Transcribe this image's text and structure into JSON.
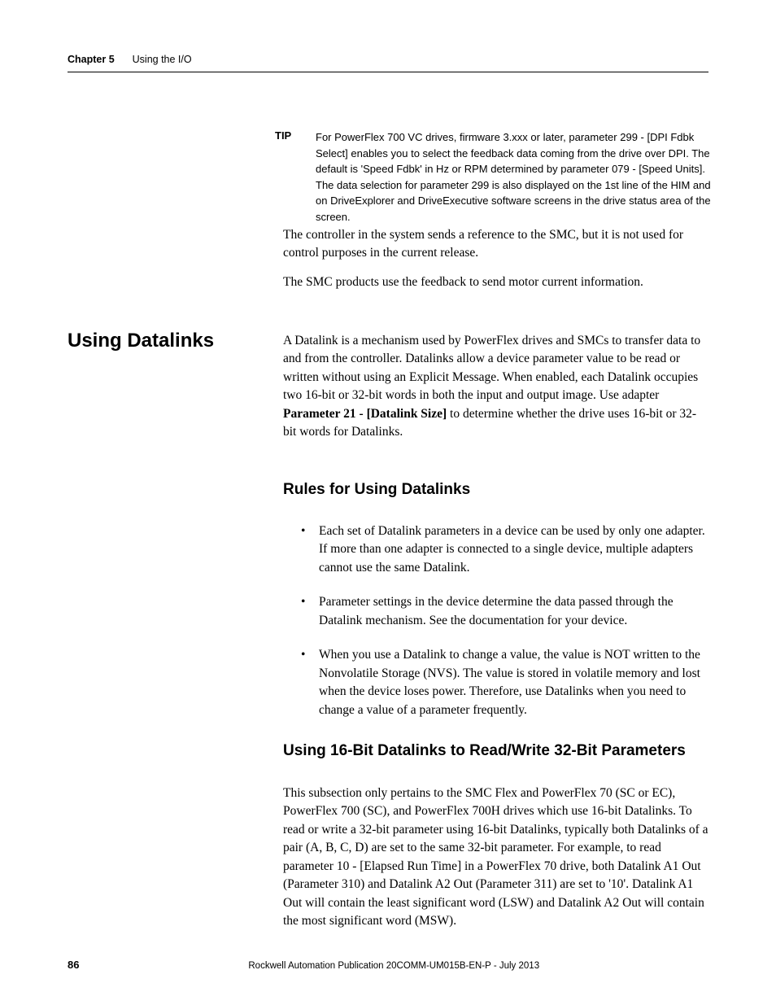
{
  "header": {
    "chapter": "Chapter 5",
    "title": "Using the I/O"
  },
  "tip": {
    "label": "TIP",
    "text": "For PowerFlex 700 VC drives, firmware 3.xxx or later, parameter 299 - [DPI Fdbk Select] enables you to select the feedback data coming from the drive over DPI. The default is 'Speed Fdbk' in Hz or RPM determined by parameter 079 - [Speed Units]. The data selection for parameter 299 is also displayed on the 1st line of the HIM and on DriveExplorer and DriveExecutive software screens in the drive status area of the screen."
  },
  "body_paras": [
    "The controller in the system sends a reference to the SMC, but it is not used for control purposes in the current release.",
    "The SMC products use the feedback to send motor current information."
  ],
  "section": {
    "heading": "Using Datalinks",
    "body_pre": "A Datalink is a mechanism used by PowerFlex drives and SMCs to transfer data to and from the controller. Datalinks allow a device parameter value to be read or written without using an Explicit Message. When enabled, each Datalink occupies two 16-bit or 32-bit words in both the input and output image. Use adapter ",
    "body_bold": "Parameter 21 - [Datalink Size]",
    "body_post": " to determine whether the drive uses 16-bit or 32-bit words for Datalinks."
  },
  "subheading1": "Rules for Using Datalinks",
  "bullets": [
    "Each set of Datalink parameters in a device can be used by only one adapter. If more than one adapter is connected to a single device, multiple adapters cannot use the same Datalink.",
    "Parameter settings in the device determine the data passed through the Datalink mechanism. See the documentation for your device.",
    "When you use a Datalink to change a value, the value is NOT written to the Nonvolatile Storage (NVS). The value is stored in volatile memory and lost when the device loses power. Therefore, use Datalinks when you need to change a value of a parameter frequently."
  ],
  "subheading2": "Using 16-Bit Datalinks to Read/Write 32-Bit Parameters",
  "subsection_body": "This subsection only pertains to the SMC Flex and PowerFlex 70 (SC or EC), PowerFlex 700 (SC), and PowerFlex 700H drives which use 16-bit Datalinks. To read or write a 32-bit parameter using 16-bit Datalinks, typically both Datalinks of a pair (A, B, C, D) are set to the same 32-bit parameter. For example, to read parameter 10 - [Elapsed Run Time] in a PowerFlex 70 drive, both Datalink A1 Out (Parameter 310) and Datalink A2 Out (Parameter 311) are set to '10'. Datalink A1 Out will contain the least significant word (LSW) and Datalink A2 Out will contain the most significant word (MSW).",
  "footer": {
    "pagenum": "86",
    "publication": "Rockwell Automation Publication 20COMM-UM015B-EN-P - July 2013"
  }
}
